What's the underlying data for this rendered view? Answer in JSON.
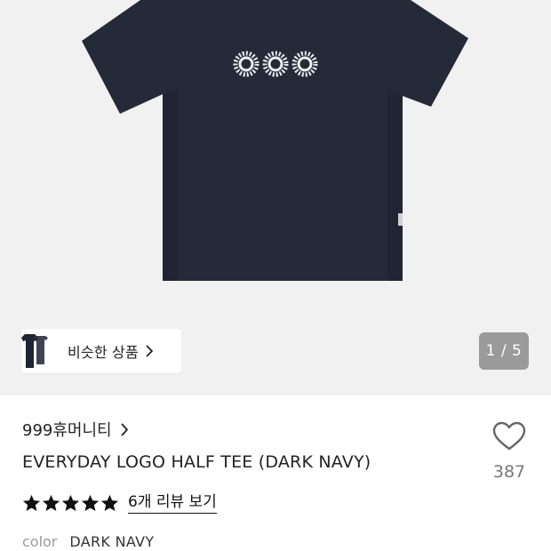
{
  "product": {
    "brand": "999휴머니티",
    "title": "EVERYDAY LOGO HALF TEE (DARK NAVY)",
    "color_label": "color",
    "color_value": "DARK NAVY",
    "shirt_color": "#252a38",
    "image_background": "#f1f1f1"
  },
  "gallery": {
    "similar_label": "비슷한 상품",
    "pager": "1 / 5"
  },
  "rating": {
    "stars": 5,
    "review_link": "6개 리뷰 보기"
  },
  "wishlist": {
    "count": "387",
    "icon": "heart-outline-icon"
  }
}
